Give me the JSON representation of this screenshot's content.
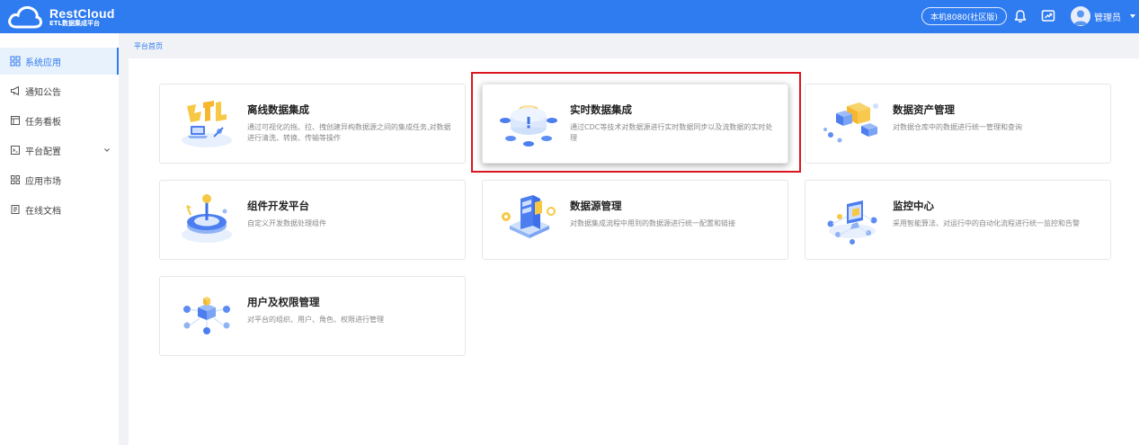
{
  "header": {
    "logo": {
      "title": "RestCloud",
      "subtitle": "ETL数据集成平台"
    },
    "env_label": "本机8080(社区版)",
    "user_name": "管理员",
    "icons": [
      "bell-icon",
      "screen-share-icon",
      "user-avatar",
      "caret-down-icon"
    ]
  },
  "sidebar": {
    "items": [
      {
        "label": "系统应用",
        "icon": "grid-icon",
        "active": true
      },
      {
        "label": "通知公告",
        "icon": "megaphone-icon"
      },
      {
        "label": "任务看板",
        "icon": "board-icon"
      },
      {
        "label": "平台配置",
        "icon": "config-icon",
        "expandable": true
      },
      {
        "label": "应用市场",
        "icon": "apps-icon"
      },
      {
        "label": "在线文档",
        "icon": "document-icon"
      }
    ]
  },
  "breadcrumb": "平台首页",
  "apps": [
    {
      "title": "离线数据集成",
      "desc": "通过可视化的拖、拉、拽创建异构数据源之间的集成任务,对数据进行清洗、转换、传输等操作",
      "icon": "etl-illustration"
    },
    {
      "title": "实时数据集成",
      "desc": "通过CDC等技术对数据源进行实时数据同步以及流数据的实时处理",
      "icon": "cdc-illustration",
      "highlighted": true
    },
    {
      "title": "数据资产管理",
      "desc": "对数据仓库中的数据进行统一管理和查询",
      "icon": "asset-illustration"
    },
    {
      "title": "组件开发平台",
      "desc": "自定义开发数据处理组件",
      "icon": "component-illustration"
    },
    {
      "title": "数据源管理",
      "desc": "对数据集成流程中用到的数据源进行统一配置和链接",
      "icon": "datasource-illustration"
    },
    {
      "title": "监控中心",
      "desc": "采用智能算法、对运行中的自动化流程进行统一监控和告警",
      "icon": "monitor-illustration"
    },
    {
      "title": "用户及权限管理",
      "desc": "对平台的组织、用户、角色、权限进行管理",
      "icon": "user-permission-illustration"
    }
  ],
  "colors": {
    "primary": "#2f7bf0",
    "highlight": "#d9161f",
    "background": "#f0f2f5"
  }
}
